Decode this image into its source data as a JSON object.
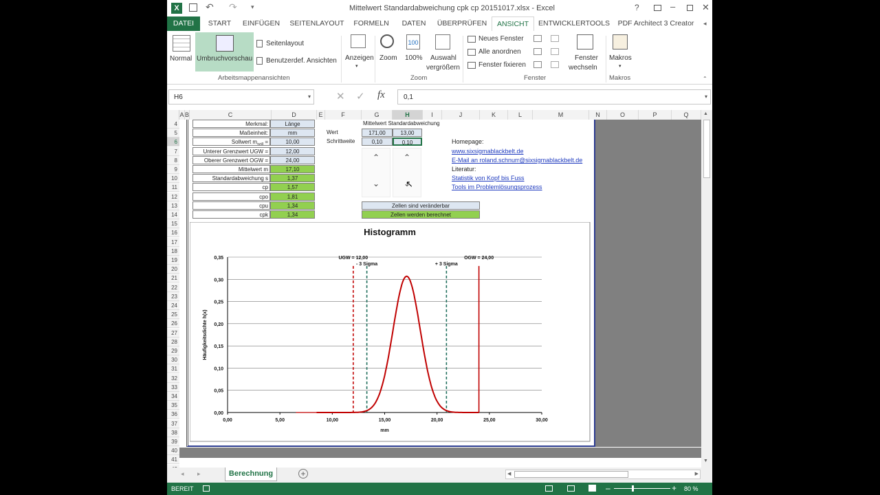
{
  "window": {
    "title": "Mittelwert Standardabweichung cpk cp 20151017.xlsx - Excel",
    "help": "?"
  },
  "tabs": [
    "DATEI",
    "START",
    "EINFÜGEN",
    "SEITENLAYOUT",
    "FORMELN",
    "DATEN",
    "ÜBERPRÜFEN",
    "ANSICHT",
    "ENTWICKLERTOOLS",
    "PDF Architect 3 Creator"
  ],
  "ribbon": {
    "normal": "Normal",
    "umbruch": "Umbruchvorschau",
    "seitenlayout": "Seitenlayout",
    "benutzer": "Benutzerdef. Ansichten",
    "group_arbeitsmappe": "Arbeitsmappenansichten",
    "anzeigen": "Anzeigen",
    "zoom": "Zoom",
    "zoom100": "100%",
    "auswahl1": "Auswahl",
    "auswahl2": "vergrößern",
    "group_zoom": "Zoom",
    "neues_fenster": "Neues Fenster",
    "alle_anordnen": "Alle anordnen",
    "fenster_fixieren": "Fenster fixieren",
    "fenster1": "Fenster",
    "fenster2": "wechseln",
    "group_fenster": "Fenster",
    "makros": "Makros",
    "group_makros": "Makros"
  },
  "formula": {
    "namebox": "H6",
    "fx": "fx",
    "value": "0,1"
  },
  "columns": [
    [
      "A",
      ""
    ],
    [
      "B",
      ""
    ],
    [
      "C",
      ""
    ],
    [
      "D",
      ""
    ],
    [
      "E",
      ""
    ],
    [
      "F",
      ""
    ],
    [
      "G",
      ""
    ],
    [
      "H",
      ""
    ],
    [
      "I",
      ""
    ],
    [
      "J",
      ""
    ],
    [
      "K",
      ""
    ],
    [
      "L",
      ""
    ],
    [
      "M",
      ""
    ],
    [
      "N",
      ""
    ],
    [
      "O",
      ""
    ],
    [
      "P",
      ""
    ],
    [
      "Q",
      ""
    ]
  ],
  "rows": [
    "4",
    "5",
    "6",
    "7",
    "8",
    "9",
    "10",
    "11",
    "12",
    "13",
    "14",
    "15",
    "16",
    "17",
    "18",
    "19",
    "20",
    "21",
    "22",
    "23",
    "24",
    "25",
    "26",
    "27",
    "28",
    "29",
    "30",
    "31",
    "32",
    "33",
    "34",
    "35",
    "36",
    "37",
    "38",
    "39",
    "40",
    "41",
    "42"
  ],
  "table": {
    "labels": [
      "Merkmal:",
      "Maßeinheit:",
      "Sollwert m",
      "Unterer Grenzwert UGW =",
      "Oberer Grenzwert OGW =",
      "Mittelwert m",
      "Standardabweichung s",
      "cp",
      "cpo",
      "cpu",
      "cpk"
    ],
    "soll_sub": "soll",
    "soll_eq": " =",
    "values": [
      "Länge",
      "mm",
      "10,00",
      "12,00",
      "24,00",
      "17,10",
      "1,37",
      "1,57",
      "1,81",
      "1,34",
      "1,34"
    ]
  },
  "params": {
    "header": "Mittelwert Standardabweichung",
    "wert": "Wert",
    "schritt": "Schrittweite",
    "g5": "171,00",
    "h5": "13,00",
    "g6": "0,10",
    "h6": "0,10"
  },
  "legend": {
    "changeable": "Zellen sind veränderbar",
    "calculated": "Zellen werden berechnet"
  },
  "links": {
    "homepage": "Homepage:",
    "url": "www.sixsigmablackbelt.de",
    "email": "E-Mail an roland.schnurr@sixsigmablackbelt.de",
    "literatur": "Literatur:",
    "book1": "Statistik von Kopf bis Fuss",
    "book2": "Tools im Problemlösungsprozess"
  },
  "sheet_tab": "Berechnung",
  "status": {
    "ready": "BEREIT",
    "zoom": "80 %"
  },
  "colors": {
    "excel_green": "#217346",
    "curve": "#c00000",
    "ugw": "#c00000",
    "sigma": "#1f6e5c"
  },
  "chart_data": {
    "type": "line",
    "title": "Histogramm",
    "xlabel": "mm",
    "ylabel": "Häufigkeitsdichte h(x)",
    "xlim": [
      0,
      30
    ],
    "ylim": [
      0,
      0.35
    ],
    "xticks": [
      "0,00",
      "5,00",
      "10,00",
      "15,00",
      "20,00",
      "25,00",
      "30,00"
    ],
    "yticks": [
      "0,00",
      "0,05",
      "0,10",
      "0,15",
      "0,20",
      "0,25",
      "0,30",
      "0,35"
    ],
    "series": [
      {
        "mean": 17.1,
        "sd": 1.3,
        "x_from": 8.5,
        "x_to": 24,
        "x": [
          9,
          11,
          13,
          14,
          15,
          16,
          17.1,
          18,
          19,
          20,
          21,
          23
        ],
        "y": [
          0.0,
          0.004,
          0.02,
          0.08,
          0.18,
          0.25,
          0.31,
          0.25,
          0.15,
          0.06,
          0.02,
          0.0
        ]
      }
    ],
    "markers": [
      {
        "label": "UGW = 12,00",
        "x": 12.0,
        "kind": "limit"
      },
      {
        "label": "- 3 Sigma",
        "x": 13.3,
        "kind": "sigma"
      },
      {
        "label": "+ 3 Sigma",
        "x": 20.9,
        "kind": "sigma"
      },
      {
        "label": "OGW = 24,00",
        "x": 24.0,
        "kind": "limit-solid"
      }
    ]
  }
}
